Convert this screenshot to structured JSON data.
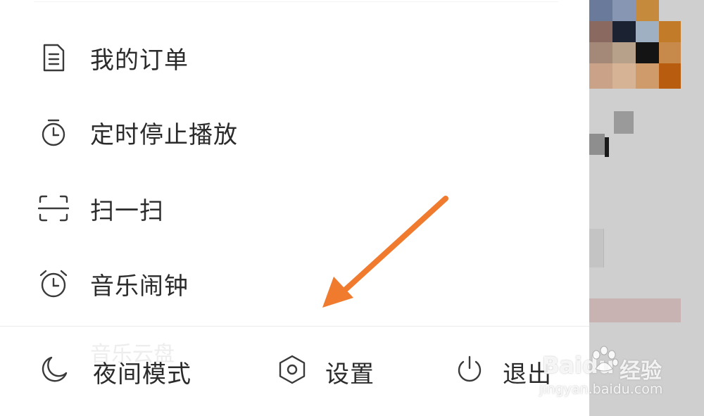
{
  "menu": {
    "items": [
      {
        "label": "我的订单",
        "icon": "order-document-icon"
      },
      {
        "label": "定时停止播放",
        "icon": "timer-icon"
      },
      {
        "label": "扫一扫",
        "icon": "scan-icon"
      },
      {
        "label": "音乐闹钟",
        "icon": "alarm-clock-icon"
      }
    ],
    "ghost_label": "音乐云盘"
  },
  "bottom_bar": {
    "night_mode_label": "夜间模式",
    "settings_label": "设置",
    "logout_label": "退出"
  },
  "watermark": {
    "brand": "Baidu",
    "product": "经验",
    "url": "jingyan.baidu.com"
  },
  "colors": {
    "annotation_arrow": "#f07b2f",
    "text": "#2b2b2b",
    "icon_stroke": "#3a3a3a",
    "dim_background": "#cfcfcf"
  }
}
